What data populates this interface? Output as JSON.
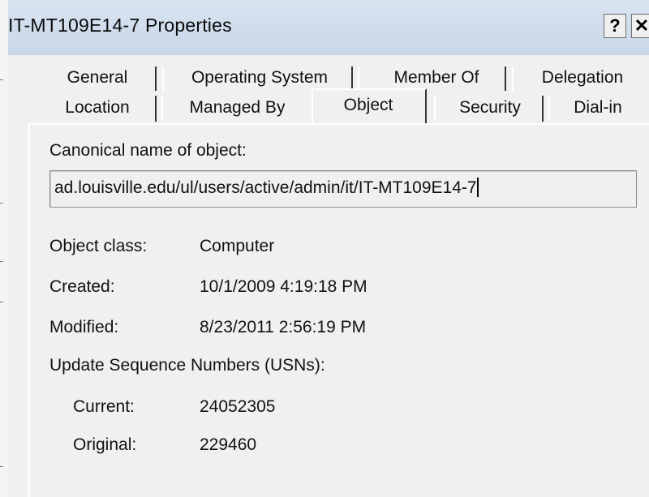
{
  "window": {
    "title": "IT-MT109E14-7 Properties",
    "help_label": "?",
    "close_label": "✕"
  },
  "tabs": {
    "row1": [
      "General",
      "Operating System",
      "Member Of",
      "Delegation"
    ],
    "row2": [
      "Location",
      "Managed By",
      "Object",
      "Security",
      "Dial-in"
    ],
    "selected": "Object"
  },
  "object": {
    "canonical_label": "Canonical name of object:",
    "canonical_value": "ad.louisville.edu/ul/users/active/admin/it/IT-MT109E14-7",
    "class_label": "Object class:",
    "class_value": "Computer",
    "created_label": "Created:",
    "created_value": "10/1/2009 4:19:18 PM",
    "modified_label": "Modified:",
    "modified_value": "8/23/2011 2:56:19 PM",
    "usn_label": "Update Sequence Numbers (USNs):",
    "current_label": "Current:",
    "current_value": "24052305",
    "original_label": "Original:",
    "original_value": "229460"
  }
}
